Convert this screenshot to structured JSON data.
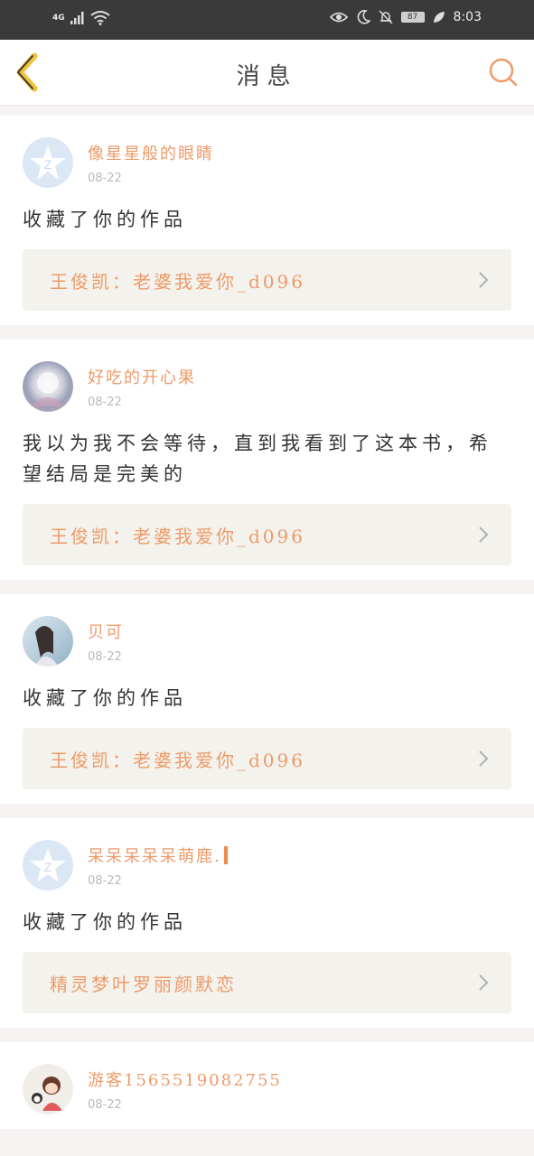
{
  "status_bar": {
    "network": "4G",
    "battery_level": "87",
    "time": "8:03"
  },
  "header": {
    "title": "消息"
  },
  "colors": {
    "accent": "#ee9a6a",
    "status_bar_bg": "#3a3a3a",
    "card_link_bg": "#f4f2ec",
    "page_bg": "#f7f3f3"
  },
  "messages": [
    {
      "username": "像星星般的眼睛",
      "date": "08-22",
      "avatar": "default-star-avatar",
      "text": "收藏了你的作品",
      "work_title": "王俊凯：老婆我爱你_d096"
    },
    {
      "username": "好吃的开心果",
      "date": "08-22",
      "avatar": "photo-avatar",
      "text": "我以为我不会等待，直到我看到了这本书，希望结局是完美的",
      "work_title": "王俊凯：老婆我爱你_d096"
    },
    {
      "username": "贝可",
      "date": "08-22",
      "avatar": "photo-avatar",
      "text": "收藏了你的作品",
      "work_title": "王俊凯：老婆我爱你_d096"
    },
    {
      "username": "呆呆呆呆呆萌鹿.",
      "date": "08-22",
      "avatar": "default-star-avatar",
      "text": "收藏了你的作品",
      "work_title": "精灵梦叶罗丽颜默恋"
    },
    {
      "username": "游客1565519082755",
      "date": "08-22",
      "avatar": "photo-avatar"
    }
  ]
}
